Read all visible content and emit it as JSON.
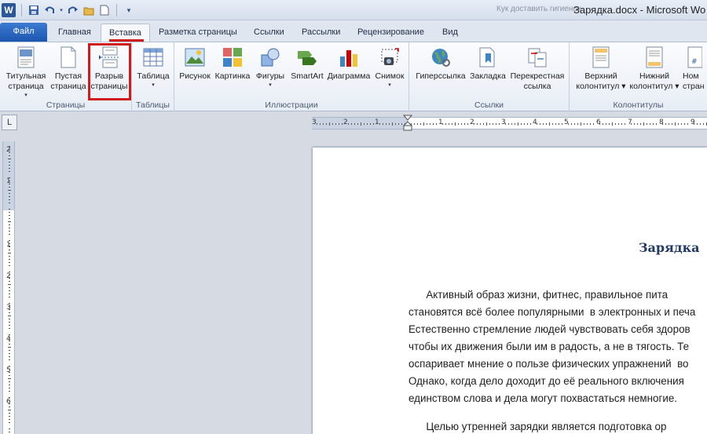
{
  "titlebar": {
    "app_icon": "W",
    "document_title": "Зарядка.docx - Microsoft Wo",
    "faded_text": "Кук доставить гигиенок"
  },
  "qat": {
    "icons": [
      "save-icon",
      "undo-icon",
      "redo-icon",
      "open-folder-icon",
      "new-document-icon",
      "customize-dropdown-icon"
    ]
  },
  "tabs": [
    {
      "label": "Файл"
    },
    {
      "label": "Главная"
    },
    {
      "label": "Вставка"
    },
    {
      "label": "Разметка страницы"
    },
    {
      "label": "Ссылки"
    },
    {
      "label": "Рассылки"
    },
    {
      "label": "Рецензирование"
    },
    {
      "label": "Вид"
    }
  ],
  "active_tab": "Вставка",
  "highlight_color": "#d11a1a",
  "ribbon": {
    "groups": {
      "pages": {
        "label": "Страницы",
        "buttons": [
          {
            "line1": "Титульная",
            "line2": "страница",
            "arrow": "▾"
          },
          {
            "line1": "Пустая",
            "line2": "страница"
          },
          {
            "line1": "Разрыв",
            "line2": "страницы"
          }
        ]
      },
      "tables": {
        "label": "Таблицы",
        "buttons": [
          {
            "line1": "Таблица",
            "arrow": "▾"
          }
        ]
      },
      "illustrations": {
        "label": "Иллюстрации",
        "buttons": [
          {
            "line1": "Рисунок"
          },
          {
            "line1": "Картинка"
          },
          {
            "line1": "Фигуры",
            "arrow": "▾"
          },
          {
            "line1": "SmartArt"
          },
          {
            "line1": "Диаграмма"
          },
          {
            "line1": "Снимок",
            "arrow": "▾"
          }
        ]
      },
      "links": {
        "label": "Ссылки",
        "buttons": [
          {
            "line1": "Гиперссылка"
          },
          {
            "line1": "Закладка"
          },
          {
            "line1": "Перекрестная",
            "line2": "ссылка"
          }
        ]
      },
      "header_footer": {
        "label": "Колонтитулы",
        "buttons": [
          {
            "line1": "Верхний",
            "line2": "колонтитул ▾"
          },
          {
            "line1": "Нижний",
            "line2": "колонтитул ▾"
          },
          {
            "line1": "Ном",
            "line2": "стран"
          }
        ]
      }
    }
  },
  "ruler": {
    "corner_symbol": "L",
    "horizontal_numbers": [
      "3",
      "2",
      "1",
      "1",
      "2",
      "3",
      "4",
      "5",
      "6",
      "7",
      "8",
      "9"
    ],
    "vertical_numbers": [
      "2",
      "1",
      "1",
      "2",
      "3",
      "4",
      "5",
      "6"
    ]
  },
  "document": {
    "heading": "Зарядка",
    "lines": [
      "      Активный образ жизни, фитнес, правильное пита",
      "становятся всё более популярными  в электронных и печа",
      "Естественно стремление людей чувствовать себя здоров",
      "чтобы их движения были им в радость, а не в тягость. Те",
      "оспаривает мнение о пользе физических упражнений  во",
      "Однако, когда дело доходит до её реального включения",
      "единством слова и дела могут похвастаться немногие.",
      "      Целью утренней зарядки является подготовка ор"
    ]
  }
}
